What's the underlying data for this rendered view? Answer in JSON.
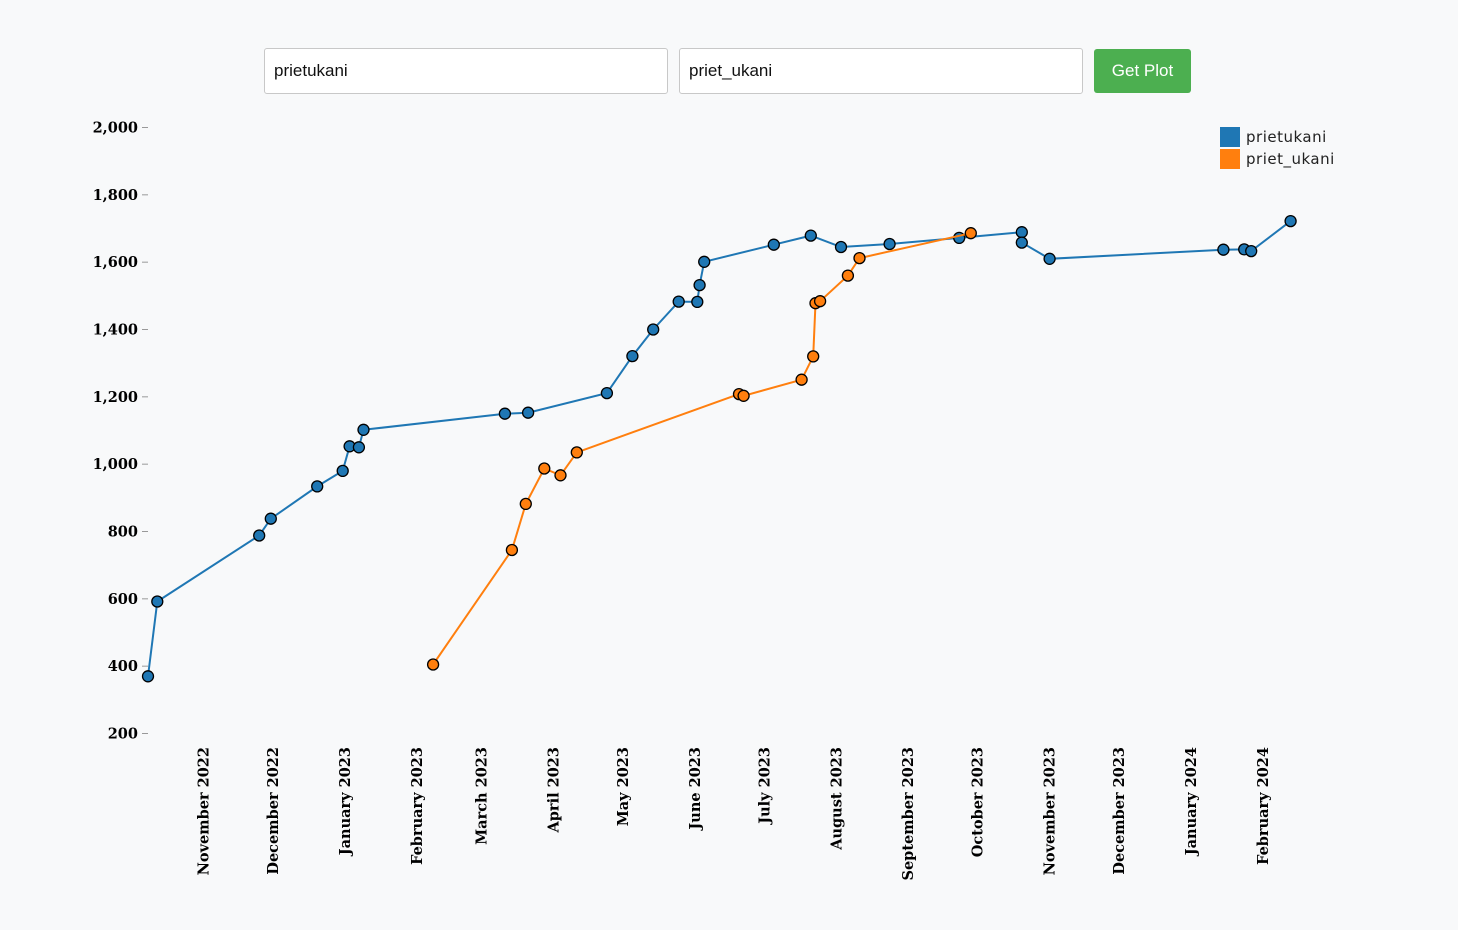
{
  "controls": {
    "user1_value": "prietukani",
    "user2_value": "priet_ukani",
    "button_label": "Get Plot"
  },
  "chart_data": {
    "type": "line",
    "title": "",
    "xlabel": "",
    "ylabel": "",
    "x_type": "date",
    "xlim": [
      "2022-10-08",
      "2024-03-01"
    ],
    "ylim": [
      200,
      2000
    ],
    "y_ticks": [
      2000,
      1800,
      1600,
      1400,
      1200,
      1000,
      800,
      600,
      400,
      200
    ],
    "y_tick_labels": [
      "2,000",
      "1,800",
      "1,600",
      "1,400",
      "1,200",
      "1,000",
      "800",
      "600",
      "400",
      "200"
    ],
    "x_ticks": [
      "2022-11-01",
      "2022-12-01",
      "2023-01-01",
      "2023-02-01",
      "2023-03-01",
      "2023-04-01",
      "2023-05-01",
      "2023-06-01",
      "2023-07-01",
      "2023-08-01",
      "2023-09-01",
      "2023-10-01",
      "2023-11-01",
      "2023-12-01",
      "2024-01-01",
      "2024-02-01"
    ],
    "x_tick_labels": [
      "November 2022",
      "December 2022",
      "January 2023",
      "February 2023",
      "March 2023",
      "April 2023",
      "May 2023",
      "June 2023",
      "July 2023",
      "August 2023",
      "September 2023",
      "October 2023",
      "November 2023",
      "December 2023",
      "January 2024",
      "February 2024"
    ],
    "grid": false,
    "legend_position": "top-right",
    "series": [
      {
        "name": "prietukani",
        "color": "#1f77b4",
        "points": [
          {
            "x": "2022-10-08",
            "y": 370
          },
          {
            "x": "2022-10-12",
            "y": 592
          },
          {
            "x": "2022-11-25",
            "y": 788
          },
          {
            "x": "2022-11-30",
            "y": 838
          },
          {
            "x": "2022-12-20",
            "y": 934
          },
          {
            "x": "2022-12-31",
            "y": 980
          },
          {
            "x": "2023-01-03",
            "y": 1053
          },
          {
            "x": "2023-01-07",
            "y": 1050
          },
          {
            "x": "2023-01-09",
            "y": 1102
          },
          {
            "x": "2023-03-11",
            "y": 1150
          },
          {
            "x": "2023-03-21",
            "y": 1153
          },
          {
            "x": "2023-04-24",
            "y": 1211
          },
          {
            "x": "2023-05-05",
            "y": 1321
          },
          {
            "x": "2023-05-14",
            "y": 1400
          },
          {
            "x": "2023-05-25",
            "y": 1483
          },
          {
            "x": "2023-06-02",
            "y": 1482
          },
          {
            "x": "2023-06-03",
            "y": 1532
          },
          {
            "x": "2023-06-05",
            "y": 1601
          },
          {
            "x": "2023-07-05",
            "y": 1652
          },
          {
            "x": "2023-07-21",
            "y": 1679
          },
          {
            "x": "2023-08-03",
            "y": 1645
          },
          {
            "x": "2023-08-24",
            "y": 1654
          },
          {
            "x": "2023-09-23",
            "y": 1672
          },
          {
            "x": "2023-10-20",
            "y": 1689
          },
          {
            "x": "2023-10-20",
            "y": 1658
          },
          {
            "x": "2023-11-01",
            "y": 1610
          },
          {
            "x": "2024-01-15",
            "y": 1637
          },
          {
            "x": "2024-01-24",
            "y": 1638
          },
          {
            "x": "2024-01-27",
            "y": 1633
          },
          {
            "x": "2024-02-13",
            "y": 1722
          }
        ]
      },
      {
        "name": "priet_ukani",
        "color": "#ff7f0e",
        "points": [
          {
            "x": "2023-02-08",
            "y": 405
          },
          {
            "x": "2023-03-14",
            "y": 745
          },
          {
            "x": "2023-03-20",
            "y": 882
          },
          {
            "x": "2023-03-28",
            "y": 987
          },
          {
            "x": "2023-04-04",
            "y": 967
          },
          {
            "x": "2023-04-11",
            "y": 1035
          },
          {
            "x": "2023-06-20",
            "y": 1208
          },
          {
            "x": "2023-06-22",
            "y": 1203
          },
          {
            "x": "2023-07-17",
            "y": 1251
          },
          {
            "x": "2023-07-22",
            "y": 1320
          },
          {
            "x": "2023-07-23",
            "y": 1478
          },
          {
            "x": "2023-07-25",
            "y": 1484
          },
          {
            "x": "2023-08-06",
            "y": 1560
          },
          {
            "x": "2023-08-11",
            "y": 1612
          },
          {
            "x": "2023-09-28",
            "y": 1686
          }
        ]
      }
    ]
  }
}
